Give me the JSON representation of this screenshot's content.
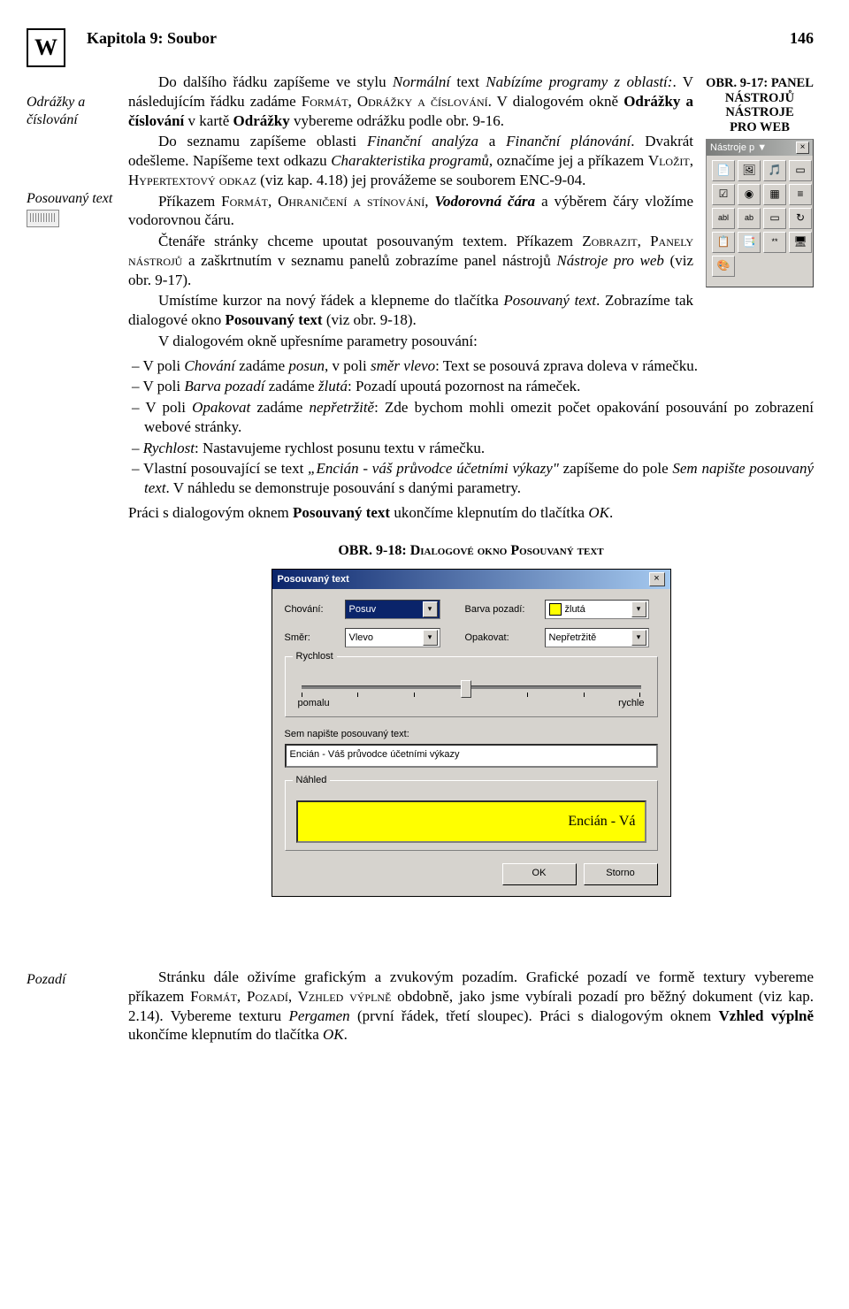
{
  "header": {
    "chapter": "Kapitola 9: Soubor",
    "page": "146"
  },
  "margin": {
    "note1a": "Odrážky a",
    "note1b": "číslování",
    "note2": "Posouvaný text",
    "note3": "Pozadí"
  },
  "float_caption": {
    "l1": "OBR. 9-17: PANEL",
    "l2": "NÁSTROJŮ NÁSTROJE",
    "l3": "PRO WEB"
  },
  "panel": {
    "title": "Nástroje p ▼"
  },
  "body": {
    "p1a": "Do dalšího řádku zapíšeme ve stylu ",
    "p1i": "Normální",
    "p1b": " text ",
    "p1i2": "Nabízíme programy z oblastí:",
    "p1c": ". V následujícím řádku zadáme ",
    "p1sc": "Formát, Odrážky a číslování",
    "p1d": ". V dialogovém okně ",
    "p1b2": "Odrážky a číslování",
    "p1e": " v kartě ",
    "p1b3": "Odrážky",
    "p1f": " vybereme odrážku podle obr. 9-16.",
    "p2a": "Do seznamu zapíšeme oblasti ",
    "p2i1": "Finanční analýza",
    "p2b": " a ",
    "p2i2": "Finanční plánování",
    "p2c": ". Dvakrát odešleme. Napíšeme text odkazu ",
    "p2i3": "Charakteristika programů",
    "p2d": ", označíme jej a příkazem ",
    "p2sc": "Vložit, Hypertextový odkaz",
    "p2e": " (viz kap. 4.18) jej provážeme se souborem ENC-9-04.",
    "p3a": "Příkazem ",
    "p3sc": "Formát, Ohraničení a stínování",
    "p3b": ", ",
    "p3i": "Vodorovná čára",
    "p3c": " a výběrem čáry vložíme vodorovnou čáru.",
    "p4a": "Čtenáře stránky chceme upoutat posouvaným textem. Příkazem ",
    "p4sc": "Zobrazit, Panely nástrojů",
    "p4b": " a zaškrtnutím v seznamu panelů zobrazíme panel nástrojů ",
    "p4i": "Nástroje pro web",
    "p4c": " (viz obr. 9-17).",
    "p5a": "Umístíme kurzor na nový řádek a klepneme do tlačítka ",
    "p5i": "Posouvaný text",
    "p5b": ". Zobrazíme tak dialogové okno ",
    "p5b2": "Posouvaný text",
    "p5c": " (viz obr. 9-18).",
    "p6": "V dialogovém okně upřesníme parametry posouvání:",
    "li1a": "V poli ",
    "li1i1": "Chování",
    "li1b": " zadáme ",
    "li1i2": "posun",
    "li1c": ", v poli ",
    "li1i3": "směr vlevo",
    "li1d": ": Text se posouvá zprava doleva v rámečku.",
    "li2a": "V poli ",
    "li2i1": "Barva pozadí",
    "li2b": " zadáme ",
    "li2i2": "žlutá",
    "li2c": ": Pozadí upoutá pozornost na rámeček.",
    "li3a": "V poli ",
    "li3i1": "Opakovat",
    "li3b": " zadáme ",
    "li3i2": "nepřetržitě",
    "li3c": ": Zde bychom mohli omezit počet opakování posouvání po zobrazení webové stránky.",
    "li4i": "Rychlost",
    "li4a": ": Nastavujeme rychlost posunu textu v rámečku.",
    "li5a": "Vlastní posouvající se text ",
    "li5i1": "„Encián - váš průvodce účetními výkazy\"",
    "li5b": " zapíšeme do pole ",
    "li5i2": "Sem napište posouvaný text",
    "li5c": ". V náhledu se demonstruje posouvání s danými parametry.",
    "p7a": "Práci s dialogovým oknem ",
    "p7b": "Posouvaný text",
    "p7c": " ukončíme klepnutím do tlačítka ",
    "p7i": "OK",
    "p7d": "."
  },
  "fig2cap": "OBR. 9-18: Dialogové okno Posouvaný text",
  "dialog": {
    "title": "Posouvaný text",
    "l_chovani": "Chování:",
    "v_chovani": "Posuv",
    "l_barva": "Barva pozadí:",
    "v_barva": "žlutá",
    "l_smer": "Směr:",
    "v_smer": "Vlevo",
    "l_opak": "Opakovat:",
    "v_opak": "Nepřetržitě",
    "grp_rychlost": "Rychlost",
    "slider_l": "pomalu",
    "slider_r": "rychle",
    "l_text": "Sem napište posouvaný text:",
    "v_text": "Encián - Váš průvodce účetními výkazy",
    "grp_nahled": "Náhled",
    "preview": "Encián - Vá",
    "ok": "OK",
    "storno": "Storno"
  },
  "bottom": {
    "p1a": "Stránku dále oživíme grafickým a zvukovým pozadím. Grafické pozadí ve formě textury vybereme příkazem ",
    "p1sc": "Formát, Pozadí, Vzhled výplně",
    "p1b": " obdobně, jako jsme vybírali pozadí pro běžný dokument (viz kap. 2.14). Vybereme texturu ",
    "p1i": "Pergamen",
    "p1c": " (první řádek, třetí sloupec). Práci s dialogovým oknem ",
    "p1bold": "Vzhled výplně",
    "p1d": " ukončíme klepnutím do tlačítka ",
    "p1i2": "OK",
    "p1e": "."
  }
}
